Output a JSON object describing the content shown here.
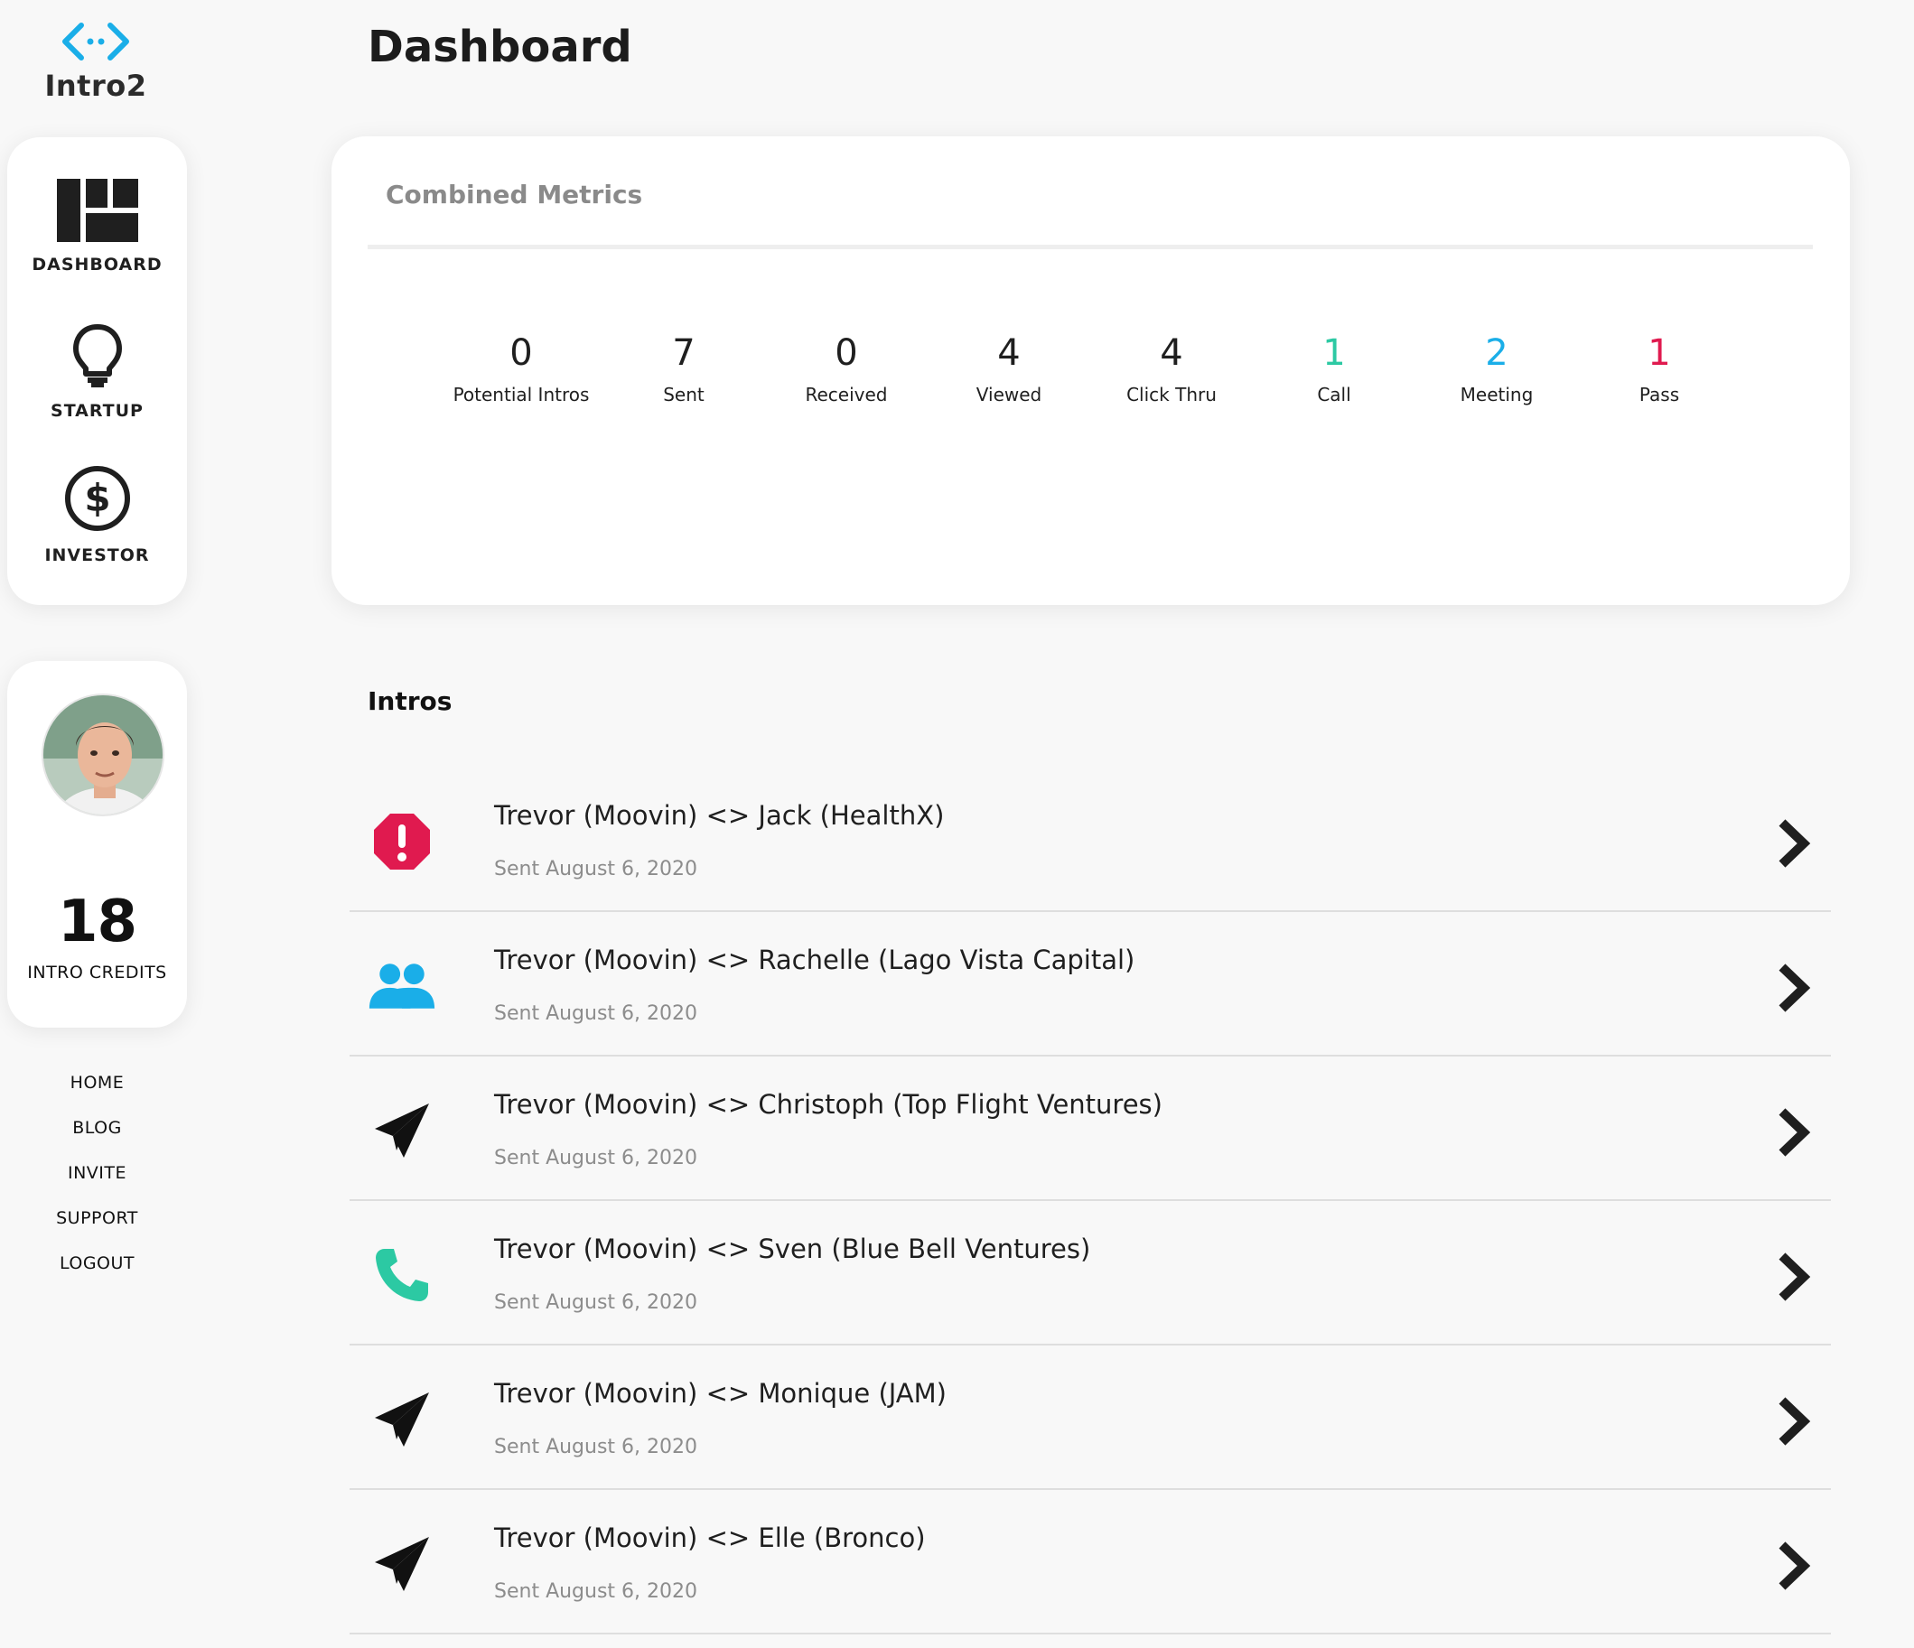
{
  "brand": {
    "name": "Intro2",
    "accent": "#1aaee8"
  },
  "nav": {
    "items": [
      {
        "label": "DASHBOARD",
        "icon": "dashboard-icon"
      },
      {
        "label": "STARTUP",
        "icon": "lightbulb-icon"
      },
      {
        "label": "INVESTOR",
        "icon": "dollar-circle-icon"
      }
    ]
  },
  "profile": {
    "credits": "18",
    "credits_label": "INTRO CREDITS"
  },
  "footer_links": [
    "HOME",
    "BLOG",
    "INVITE",
    "SUPPORT",
    "LOGOUT"
  ],
  "page": {
    "title": "Dashboard"
  },
  "metrics": {
    "title": "Combined Metrics",
    "items": [
      {
        "value": "0",
        "label": "Potential Intros",
        "color": "#1f1f1f"
      },
      {
        "value": "7",
        "label": "Sent",
        "color": "#1f1f1f"
      },
      {
        "value": "0",
        "label": "Received",
        "color": "#1f1f1f"
      },
      {
        "value": "4",
        "label": "Viewed",
        "color": "#1f1f1f"
      },
      {
        "value": "4",
        "label": "Click Thru",
        "color": "#1f1f1f"
      },
      {
        "value": "1",
        "label": "Call",
        "color": "#2cc9a3"
      },
      {
        "value": "2",
        "label": "Meeting",
        "color": "#1aaee8"
      },
      {
        "value": "1",
        "label": "Pass",
        "color": "#e01a4f"
      }
    ]
  },
  "intros": {
    "title": "Intros",
    "items": [
      {
        "title": "Trevor (Moovin) <> Jack (HealthX)",
        "date": "Sent August 6, 2020",
        "icon": "alert-octagon-icon",
        "color": "#e01a4f"
      },
      {
        "title": "Trevor (Moovin) <> Rachelle (Lago Vista Capital)",
        "date": "Sent August 6, 2020",
        "icon": "people-icon",
        "color": "#1aaee8"
      },
      {
        "title": "Trevor (Moovin) <> Christoph (Top Flight Ventures)",
        "date": "Sent August 6, 2020",
        "icon": "paper-plane-icon",
        "color": "#111111"
      },
      {
        "title": "Trevor (Moovin) <> Sven (Blue Bell Ventures)",
        "date": "Sent August 6, 2020",
        "icon": "phone-icon",
        "color": "#2cc9a3"
      },
      {
        "title": "Trevor (Moovin) <> Monique (JAM)",
        "date": "Sent August 6, 2020",
        "icon": "paper-plane-icon",
        "color": "#111111"
      },
      {
        "title": "Trevor (Moovin) <> Elle (Bronco)",
        "date": "Sent August 6, 2020",
        "icon": "paper-plane-icon",
        "color": "#111111"
      }
    ]
  }
}
